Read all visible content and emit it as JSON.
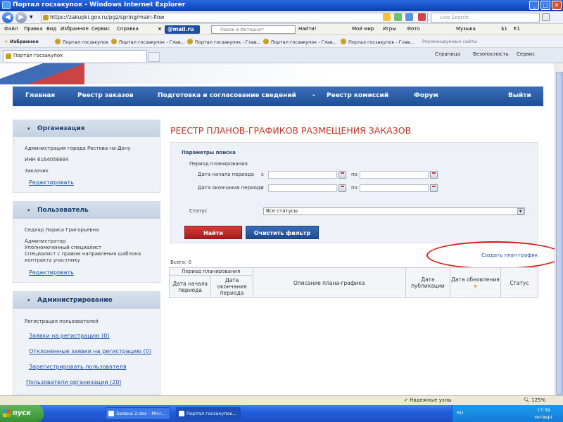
{
  "window": {
    "title": "Портал госзакупок - Windows Internet Explorer",
    "minimize": "_",
    "maximize": "□",
    "close": "✕"
  },
  "address": {
    "url": "https://zakupki.gov.ru/pgz/spring/main-flow",
    "live_search_placeholder": "Live Search"
  },
  "menu": {
    "items": [
      "Файл",
      "Правка",
      "Вид",
      "Избранное",
      "Сервис",
      "Справка"
    ],
    "mail_logo": "@mail.ru",
    "internet_search_placeholder": "Поиск в Интернет",
    "find_label": "Найти!",
    "right_items": [
      "Мой мир",
      "Игры",
      "Фото"
    ],
    "music_label": "Музыка",
    "currency": [
      "$1",
      "€1"
    ]
  },
  "favorites": {
    "label": "Избранное",
    "items": [
      "Портал госзакупок",
      "Портал госзакупок - Глав...",
      "Портал госзакупок - Глав...",
      "Портал госзакупок - Глав...",
      "Портал госзакупок - Глав..."
    ],
    "recommended": "Рекомендуемые сайты"
  },
  "tabs": {
    "active": "Портал госзакупок",
    "commands": [
      "Страница",
      "Безопасность",
      "Сервис"
    ]
  },
  "site_nav": {
    "items": [
      "Главная",
      "Реестр заказов",
      "Подготовка и согласование сведений",
      "-",
      "Реестр комиссий",
      "Форум",
      "Выйти"
    ]
  },
  "sidebar": {
    "organization": {
      "title": "Организация",
      "name": "Администрация города Ростова-на-Дону",
      "inn": "ИНН 6164056684",
      "role": "Заказчик",
      "edit": "Редактировать"
    },
    "user": {
      "title": "Пользователь",
      "name": "Седляр Лариса Григорьевна",
      "roles": [
        "Администратор",
        "Уполномоченный специалист",
        "Специалист с правом направления шаблона",
        "контракта участнику"
      ],
      "edit": "Редактировать"
    },
    "admin": {
      "title": "Администрирование",
      "section": "Регистрация пользователей",
      "links": [
        "Заявки на регистрацию (0)",
        "Отклоненные заявки на регистрацию (0)",
        "Зарегистрировать пользователя"
      ],
      "org_users": "Пользователи организации (20)"
    }
  },
  "main": {
    "title": "РЕЕСТР ПЛАНОВ-ГРАФИКОВ РАЗМЕЩЕНИЯ ЗАКАЗОВ",
    "search": {
      "title": "Параметры поиска",
      "period_label": "Период планирования",
      "start_label": "Дата начала периода",
      "end_label": "Дата окончания периода",
      "from": "с",
      "to": "по",
      "status_label": "Статус",
      "status_value": "Все статусы",
      "find_button": "Найти",
      "clear_button": "Очистить фильтр"
    },
    "create_link": "Создать план-график",
    "total": "Всего: 0",
    "table": {
      "group_header": "Период планирования",
      "columns": [
        "Дата начала периода",
        "Дата окончания периода",
        "Описание плана-графика",
        "Дата публикации",
        "Дата обновления",
        "Статус"
      ]
    }
  },
  "statusbar": {
    "zone": "Надежные узлы",
    "zoom": "125%"
  },
  "taskbar": {
    "start": "пуск",
    "tasks": [
      "Заявка 2.doc - Micr...",
      "Портал госзакупок..."
    ],
    "lang": "RU",
    "time": "17:39",
    "day": "четверг"
  },
  "colors": {
    "title_red": "#c0392b",
    "nav_blue": "#1f4f95",
    "link_blue": "#1a4ea8",
    "annotation_red": "#e01818"
  }
}
